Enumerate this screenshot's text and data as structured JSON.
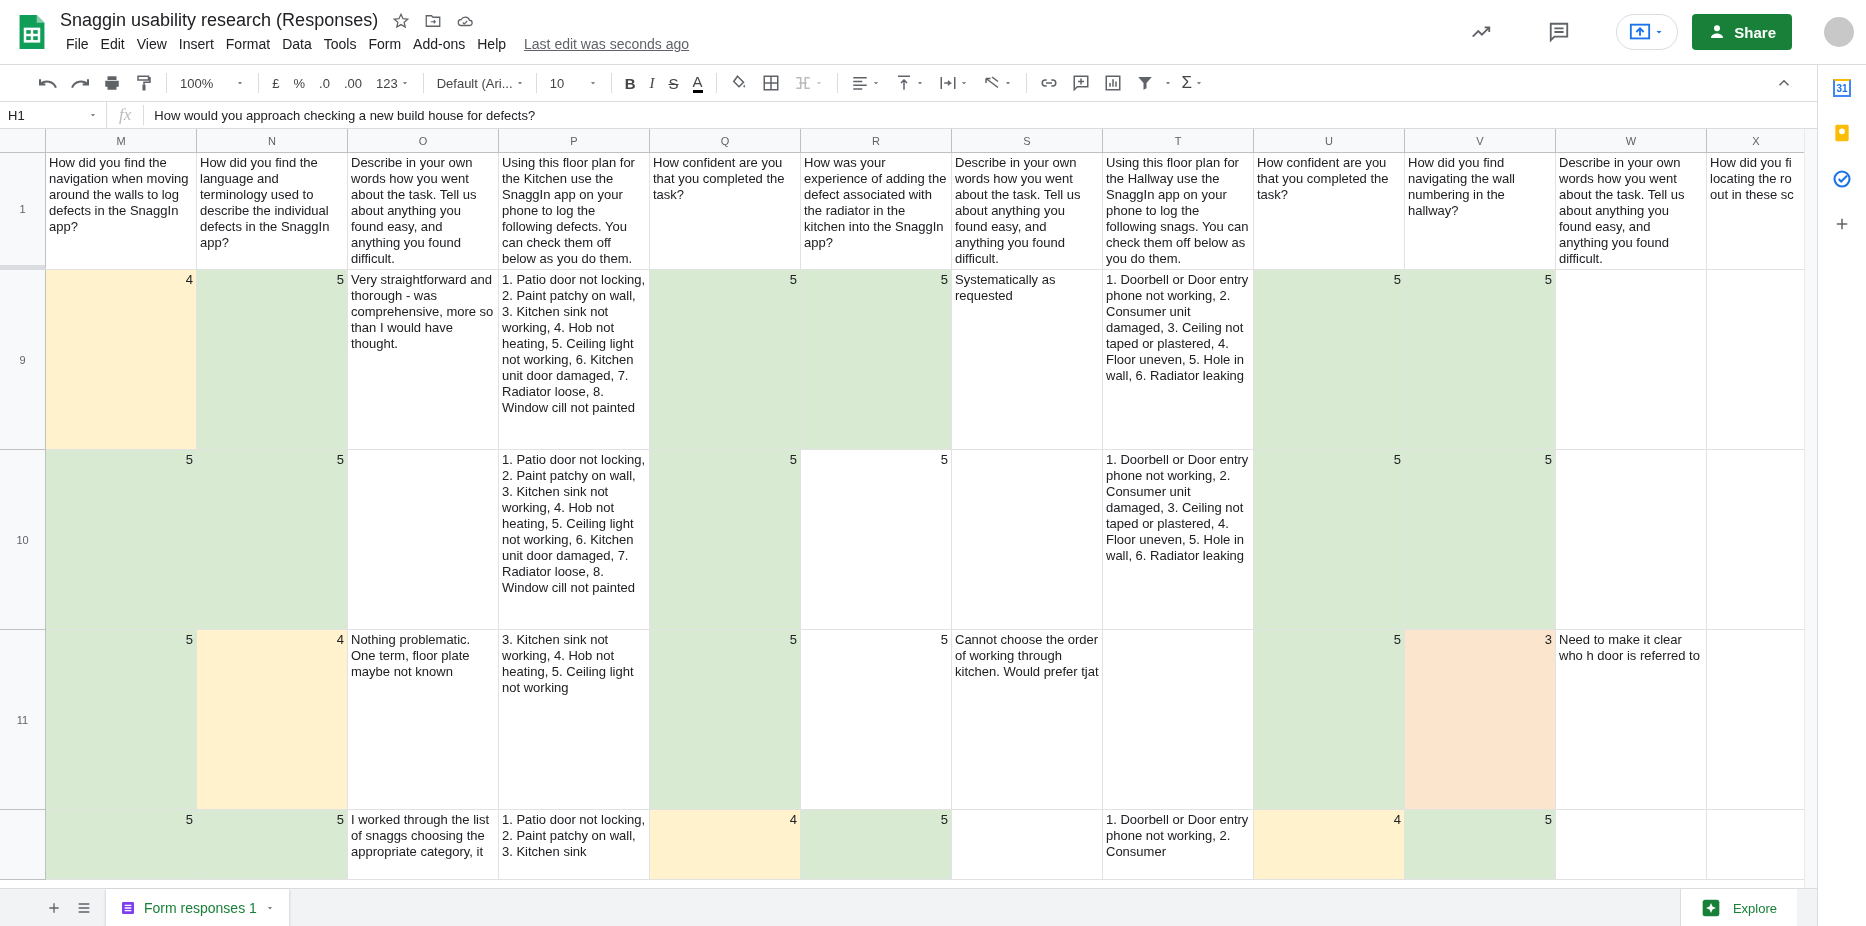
{
  "document": {
    "title": "Snaggin usability research (Responses)",
    "last_edit": "Last edit was seconds ago"
  },
  "menu": [
    "File",
    "Edit",
    "View",
    "Insert",
    "Format",
    "Data",
    "Tools",
    "Form",
    "Add-ons",
    "Help"
  ],
  "share_button": "Share",
  "toolbar": {
    "zoom": "100%",
    "currency": "£",
    "percent": "%",
    "decimal_less": ".0",
    "decimal_more": ".00",
    "number_format": "123",
    "font": "Default (Ari...",
    "font_size": "10",
    "bold": "B",
    "italic": "I",
    "strikethrough": "S",
    "text_color": "A",
    "functions": "Σ"
  },
  "formula_bar": {
    "cell_ref": "H1",
    "fx": "fx",
    "value": "How would you approach checking a new build house for defects?"
  },
  "columns": [
    "M",
    "N",
    "O",
    "P",
    "Q",
    "R",
    "S",
    "T",
    "U",
    "V",
    "W",
    "X"
  ],
  "header_row": {
    "label": "1",
    "cells": [
      "How did you find the navigation when moving around the walls to log defects in the SnaggIn app?",
      "How did you find the language and terminology used to describe the individual defects in the SnaggIn app?",
      "Describe in your own words how you went about the task. Tell us about anything you found easy, and anything you found difficult.",
      "Using this floor plan for the Kitchen use the SnaggIn app on your phone to log the following defects. You can check them off below as you do them.",
      "How confident are you that you completed the task?",
      "How was your experience of adding the defect associated with the radiator in the kitchen into the SnaggIn app?",
      "Describe in your own words how you went about the task. Tell us about anything you found easy, and anything you found difficult.",
      "Using this floor plan for the Hallway use the SnaggIn app on your phone to log the following snags. You can check them off below as you do them.",
      "How confident are you that you completed the task?",
      "How did you find navigating the wall numbering in the hallway?",
      "Describe in your own words how you went about the task. Tell us about anything you found easy, and anything you found difficult.",
      "How did you fi\nlocating the ro\nout in these sc"
    ]
  },
  "rows": [
    {
      "label": "9",
      "cells": [
        {
          "kind": "number",
          "text": "4",
          "color": "#fff2cc"
        },
        {
          "kind": "number",
          "text": "5",
          "color": "#d9ead3"
        },
        {
          "kind": "text",
          "text": "Very straightforward and thorough - was comprehensive, more so than I would have thought."
        },
        {
          "kind": "text",
          "text": "1. Patio door not locking, 2. Paint patchy on wall, 3. Kitchen sink not working, 4. Hob not heating, 5. Ceiling light not working, 6. Kitchen unit door damaged, 7. Radiator loose, 8. Window cill not painted"
        },
        {
          "kind": "number",
          "text": "5",
          "color": "#d9ead3"
        },
        {
          "kind": "number",
          "text": "5",
          "color": "#d9ead3"
        },
        {
          "kind": "text",
          "text": "Systematically as requested"
        },
        {
          "kind": "text",
          "text": "1. Doorbell or Door entry phone not working, 2. Consumer unit damaged, 3. Ceiling not taped or plastered, 4. Floor uneven, 5. Hole in wall, 6. Radiator leaking"
        },
        {
          "kind": "number",
          "text": "5",
          "color": "#d9ead3"
        },
        {
          "kind": "number",
          "text": "5",
          "color": "#d9ead3"
        },
        {
          "kind": "text"
        },
        {
          "kind": "text"
        }
      ]
    },
    {
      "label": "10",
      "cells": [
        {
          "kind": "number",
          "text": "5",
          "color": "#d9ead3"
        },
        {
          "kind": "number",
          "text": "5",
          "color": "#d9ead3"
        },
        {
          "kind": "text"
        },
        {
          "kind": "text",
          "text": "1. Patio door not locking, 2. Paint patchy on wall, 3. Kitchen sink not working, 4. Hob not heating, 5. Ceiling light not working, 6. Kitchen unit door damaged, 7. Radiator loose, 8. Window cill not painted"
        },
        {
          "kind": "number",
          "text": "5",
          "color": "#d9ead3"
        },
        {
          "kind": "number",
          "text": "5"
        },
        {
          "kind": "text"
        },
        {
          "kind": "text",
          "text": "1. Doorbell or Door entry phone not working, 2. Consumer unit damaged, 3. Ceiling not taped or plastered, 4. Floor uneven, 5. Hole in wall, 6. Radiator leaking"
        },
        {
          "kind": "number",
          "text": "5",
          "color": "#d9ead3"
        },
        {
          "kind": "number",
          "text": "5",
          "color": "#d9ead3"
        },
        {
          "kind": "text"
        },
        {
          "kind": "text"
        }
      ]
    },
    {
      "label": "11",
      "cells": [
        {
          "kind": "number",
          "text": "5",
          "color": "#d9ead3"
        },
        {
          "kind": "number",
          "text": "4",
          "color": "#fff2cc"
        },
        {
          "kind": "text",
          "text": "Nothing problematic. One term, floor plate maybe not known"
        },
        {
          "kind": "text",
          "text": "3. Kitchen sink not working, 4. Hob not heating, 5. Ceiling light not working"
        },
        {
          "kind": "number",
          "text": "5",
          "color": "#d9ead3"
        },
        {
          "kind": "number",
          "text": "5"
        },
        {
          "kind": "text",
          "text": "Cannot choose the order of working through kitchen. Would prefer tjat"
        },
        {
          "kind": "text"
        },
        {
          "kind": "number",
          "text": "5",
          "color": "#d9ead3"
        },
        {
          "kind": "number",
          "text": "3",
          "color": "#fce5cd"
        },
        {
          "kind": "text",
          "text": "Need to make it clear who h door is referred to"
        },
        {
          "kind": "text"
        }
      ]
    },
    {
      "cells": [
        {
          "kind": "number",
          "text": "5",
          "color": "#d9ead3"
        },
        {
          "kind": "number",
          "text": "5",
          "color": "#d9ead3"
        },
        {
          "kind": "text",
          "text": "I worked through the list of snaggs choosing the appropriate category, it"
        },
        {
          "kind": "text",
          "text": "1. Patio door not locking, 2. Paint patchy on wall, 3. Kitchen sink"
        },
        {
          "kind": "number",
          "text": "4",
          "color": "#fff2cc"
        },
        {
          "kind": "number",
          "text": "5",
          "color": "#d9ead3"
        },
        {
          "kind": "text"
        },
        {
          "kind": "text",
          "text": "1. Doorbell or Door entry phone not working, 2. Consumer"
        },
        {
          "kind": "number",
          "text": "4",
          "color": "#fff2cc"
        },
        {
          "kind": "number",
          "text": "5",
          "color": "#d9ead3"
        },
        {
          "kind": "text"
        },
        {
          "kind": "text"
        }
      ]
    }
  ],
  "sheet_tabs": [
    {
      "label": "Form responses 1",
      "selected": true
    }
  ],
  "explore_button": "Explore",
  "side_panel": {
    "calendar_day": "31"
  }
}
